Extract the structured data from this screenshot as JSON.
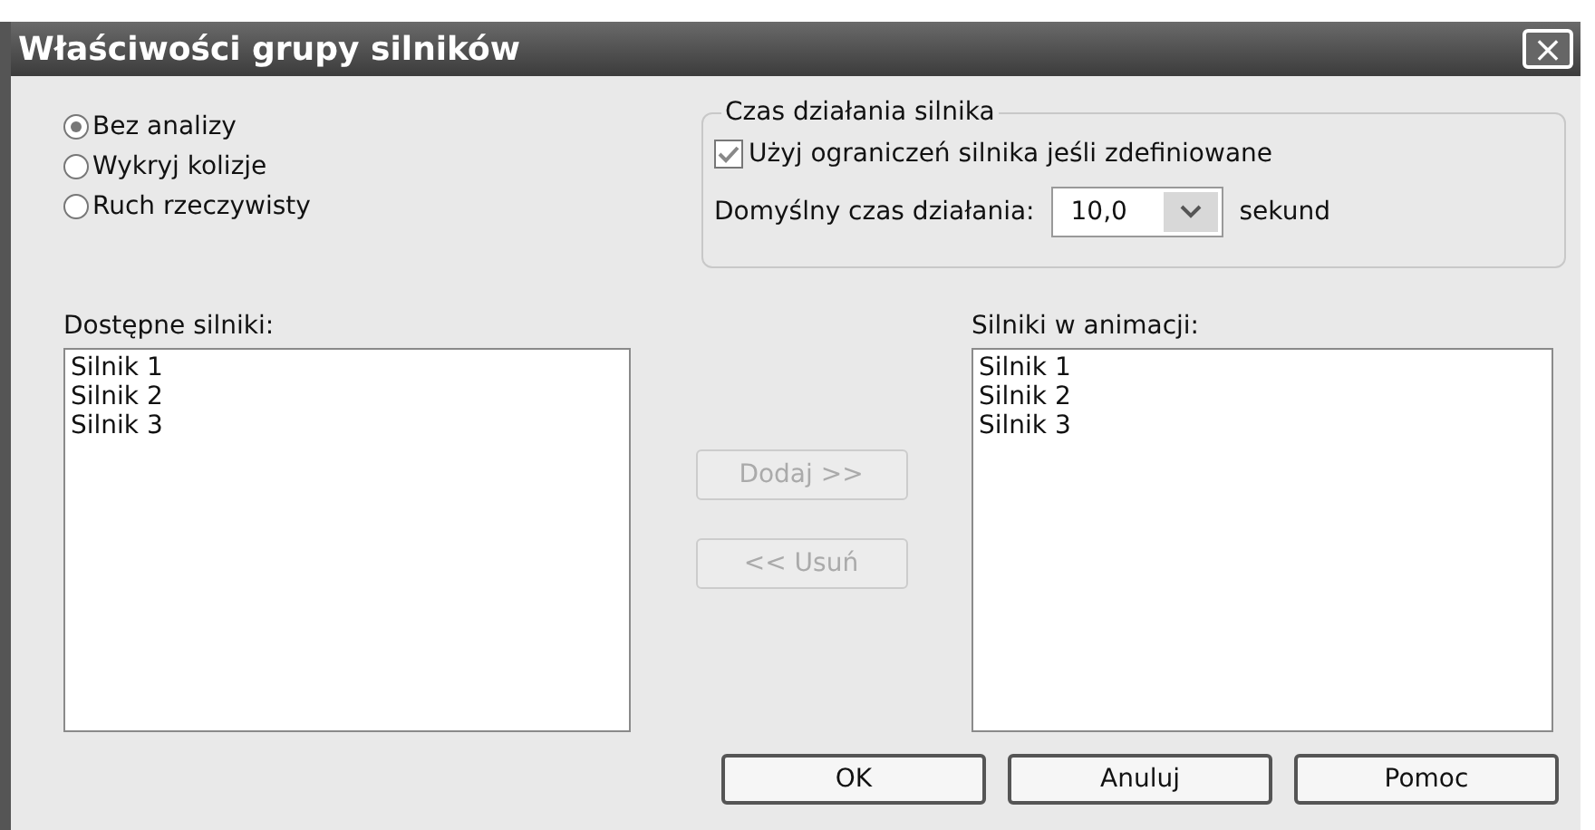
{
  "window": {
    "title": "Właściwości grupy silników",
    "close": "×"
  },
  "analysis": [
    {
      "label": "Bez analizy",
      "selected": true
    },
    {
      "label": "Wykryj kolizje",
      "selected": false
    },
    {
      "label": "Ruch rzeczywisty",
      "selected": false
    }
  ],
  "motor_time": {
    "title": "Czas działania silnika",
    "use_limits": {
      "label": "Użyj ograniczeń silnika jeśli zdefiniowane",
      "checked": true
    },
    "default_label": "Domyślny czas działania:",
    "default_value": "10,0",
    "unit": "sekund"
  },
  "available": {
    "label": "Dostępne silniki:",
    "items": [
      "Silnik 1",
      "Silnik 2",
      "Silnik 3"
    ]
  },
  "in_animation": {
    "label": "Silniki w animacji:",
    "items": [
      "Silnik 1",
      "Silnik 2",
      "Silnik 3"
    ]
  },
  "move_buttons": [
    {
      "label": "Dodaj >>",
      "disabled": true
    },
    {
      "label": "<< Usuń",
      "disabled": true
    }
  ],
  "buttons": [
    "OK",
    "Anuluj",
    "Pomoc"
  ]
}
